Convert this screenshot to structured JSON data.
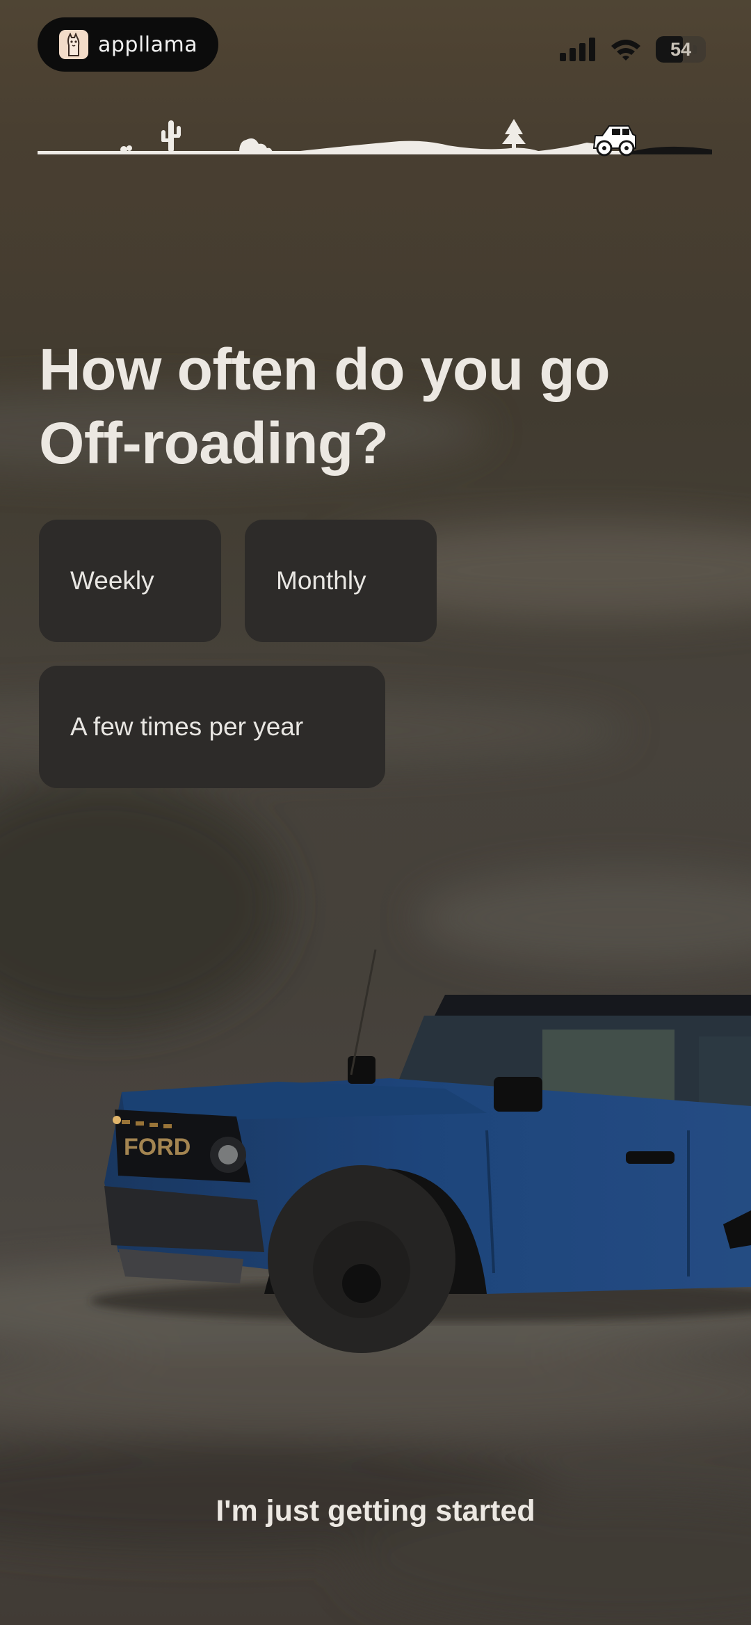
{
  "status_bar": {
    "app_name": "appllama",
    "battery_level": "54",
    "battery_fraction": 0.54,
    "icons": [
      "llama-logo-icon",
      "cellular-signal-icon",
      "wifi-icon",
      "battery-icon"
    ]
  },
  "progress": {
    "icons": [
      "cactus-icon",
      "rock-icon",
      "pine-tree-icon",
      "off-road-truck-icon"
    ]
  },
  "question": {
    "line1": "How often do you go",
    "line2": "Off-roading?"
  },
  "options": [
    {
      "label": "Weekly"
    },
    {
      "label": "Monthly"
    },
    {
      "label": "A few times per year"
    }
  ],
  "skip_label": "I'm just getting started",
  "colors": {
    "option_bg": "#2d2b29",
    "text": "#ece8e2",
    "truck_body": "#1f4f8a"
  }
}
